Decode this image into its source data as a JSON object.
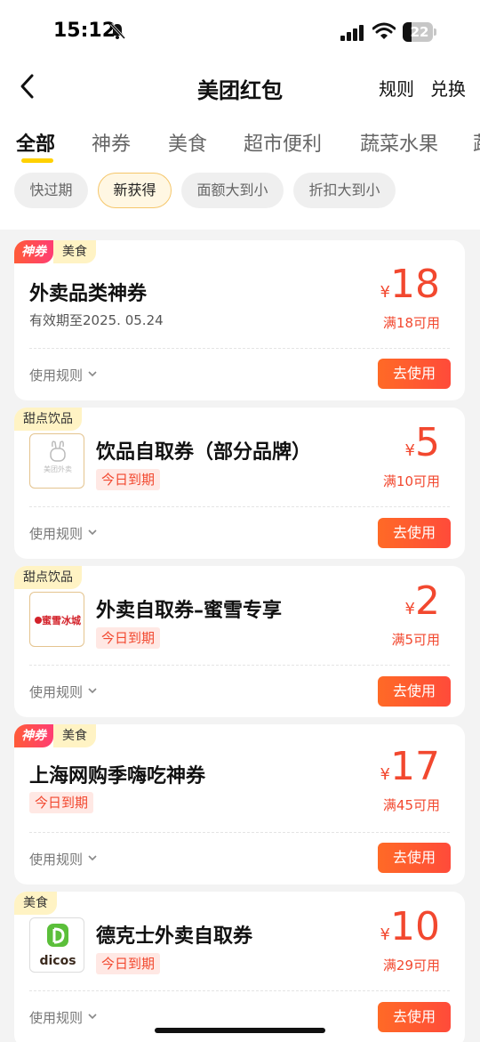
{
  "status_bar": {
    "time": "15:12",
    "battery": "22"
  },
  "nav": {
    "title": "美团红包",
    "rules": "规则",
    "exchange": "兑换"
  },
  "tabs": [
    {
      "label": "全部"
    },
    {
      "label": "神券"
    },
    {
      "label": "美食"
    },
    {
      "label": "超市便利"
    },
    {
      "label": "蔬菜水果"
    },
    {
      "label": "蔬"
    }
  ],
  "filters": [
    {
      "label": "快过期"
    },
    {
      "label": "新获得"
    },
    {
      "label": "面额大到小"
    },
    {
      "label": "折扣大到小"
    }
  ],
  "coupons": [
    {
      "tag_shen": "神券",
      "tag_cat": "美食",
      "title": "外卖品类神券",
      "subtitle": "有效期至2025. 05.24",
      "yen": "¥",
      "amount": "18",
      "condition": "满18可用",
      "rules": "使用规则",
      "button": "去使用"
    },
    {
      "tag_cat": "甜点饮品",
      "logo_text": "美团外卖",
      "title": "饮品自取券（部分品牌）",
      "badge": "今日到期",
      "yen": "¥",
      "amount": "5",
      "condition": "满10可用",
      "rules": "使用规则",
      "button": "去使用"
    },
    {
      "tag_cat": "甜点饮品",
      "logo_text": "蜜雪冰城",
      "title": "外卖自取券–蜜雪专享",
      "badge": "今日到期",
      "yen": "¥",
      "amount": "2",
      "condition": "满5可用",
      "rules": "使用规则",
      "button": "去使用"
    },
    {
      "tag_shen": "神券",
      "tag_cat": "美食",
      "title": "上海网购季嗨吃神券",
      "badge": "今日到期",
      "yen": "¥",
      "amount": "17",
      "condition": "满45可用",
      "rules": "使用规则",
      "button": "去使用"
    },
    {
      "tag_cat": "美食",
      "logo_text": "dicos",
      "title": "德克士外卖自取券",
      "badge": "今日到期",
      "yen": "¥",
      "amount": "10",
      "condition": "满29可用",
      "rules": "使用规则",
      "button": "去使用"
    }
  ],
  "colors": {
    "accent": "#f2482f",
    "tab_underline": "#ffd100",
    "tag_bg": "#fff3c4"
  }
}
